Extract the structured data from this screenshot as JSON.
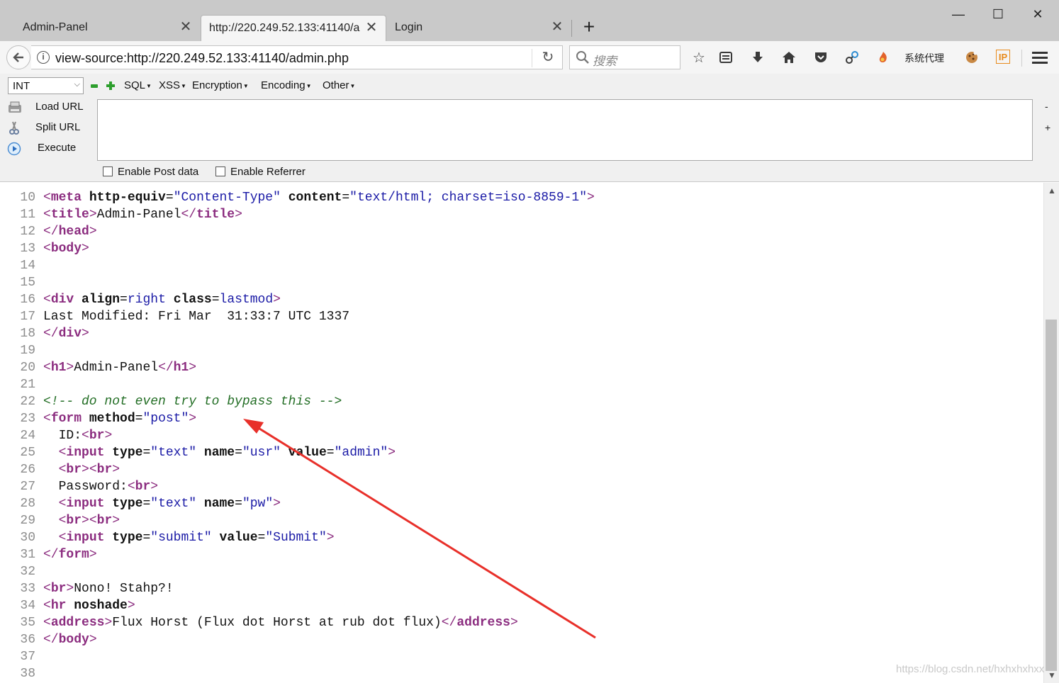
{
  "tabs": [
    {
      "label": "Admin-Panel"
    },
    {
      "label": "http://220.249.52.133:41140/a"
    },
    {
      "label": "Login"
    }
  ],
  "window_controls": {
    "minimize": "—",
    "maximize": "☐",
    "close": "✕"
  },
  "newtab_label": "+",
  "urlbar": {
    "url": "view-source:http://220.249.52.133:41140/admin.php"
  },
  "search": {
    "placeholder": "搜索"
  },
  "toolbar": {
    "proxy_label": "系统代理",
    "ip_label": "IP"
  },
  "hackbar": {
    "select_value": "INT",
    "menus": [
      "SQL",
      "XSS",
      "Encryption",
      "Encoding",
      "Other"
    ],
    "actions": [
      "Load URL",
      "Split URL",
      "Execute"
    ],
    "textarea_value": "",
    "side_buttons": [
      "-",
      "+"
    ],
    "checkboxes": [
      "Enable Post data",
      "Enable Referrer"
    ]
  },
  "source_lines": [
    {
      "n": "10",
      "segs": [
        [
          "br",
          "<"
        ],
        [
          "tag",
          "meta"
        ],
        [
          "txt",
          " "
        ],
        [
          "attr",
          "http-equiv"
        ],
        [
          "txt",
          "="
        ],
        [
          "val",
          "\"Content-Type\""
        ],
        [
          "txt",
          " "
        ],
        [
          "attr",
          "content"
        ],
        [
          "txt",
          "="
        ],
        [
          "val",
          "\"text/html; charset=iso-8859-1\""
        ],
        [
          "br",
          ">"
        ]
      ]
    },
    {
      "n": "11",
      "segs": [
        [
          "br",
          "<"
        ],
        [
          "tag",
          "title"
        ],
        [
          "br",
          ">"
        ],
        [
          "txt",
          "Admin-Panel"
        ],
        [
          "br",
          "</"
        ],
        [
          "tag",
          "title"
        ],
        [
          "br",
          ">"
        ]
      ]
    },
    {
      "n": "12",
      "segs": [
        [
          "br",
          "</"
        ],
        [
          "tag",
          "head"
        ],
        [
          "br",
          ">"
        ]
      ]
    },
    {
      "n": "13",
      "segs": [
        [
          "br",
          "<"
        ],
        [
          "tag",
          "body"
        ],
        [
          "br",
          ">"
        ]
      ]
    },
    {
      "n": "14",
      "segs": []
    },
    {
      "n": "15",
      "segs": []
    },
    {
      "n": "16",
      "segs": [
        [
          "br",
          "<"
        ],
        [
          "tag",
          "div"
        ],
        [
          "txt",
          " "
        ],
        [
          "attr",
          "align"
        ],
        [
          "txt",
          "="
        ],
        [
          "val",
          "right"
        ],
        [
          "txt",
          " "
        ],
        [
          "attr",
          "class"
        ],
        [
          "txt",
          "="
        ],
        [
          "val",
          "lastmod"
        ],
        [
          "br",
          ">"
        ]
      ]
    },
    {
      "n": "17",
      "segs": [
        [
          "txt",
          "Last Modified: Fri Mar  31:33:7 UTC 1337"
        ]
      ]
    },
    {
      "n": "18",
      "segs": [
        [
          "br",
          "</"
        ],
        [
          "tag",
          "div"
        ],
        [
          "br",
          ">"
        ]
      ]
    },
    {
      "n": "19",
      "segs": []
    },
    {
      "n": "20",
      "segs": [
        [
          "br",
          "<"
        ],
        [
          "tag",
          "h1"
        ],
        [
          "br",
          ">"
        ],
        [
          "txt",
          "Admin-Panel"
        ],
        [
          "br",
          "</"
        ],
        [
          "tag",
          "h1"
        ],
        [
          "br",
          ">"
        ]
      ]
    },
    {
      "n": "21",
      "segs": []
    },
    {
      "n": "22",
      "segs": [
        [
          "cmt",
          "<!-- do not even try to bypass this -->"
        ]
      ]
    },
    {
      "n": "23",
      "segs": [
        [
          "br",
          "<"
        ],
        [
          "tag",
          "form"
        ],
        [
          "txt",
          " "
        ],
        [
          "attr",
          "method"
        ],
        [
          "txt",
          "="
        ],
        [
          "val",
          "\"post\""
        ],
        [
          "br",
          ">"
        ]
      ]
    },
    {
      "n": "24",
      "segs": [
        [
          "txt",
          "  ID:"
        ],
        [
          "br",
          "<"
        ],
        [
          "tag",
          "br"
        ],
        [
          "br",
          ">"
        ]
      ]
    },
    {
      "n": "25",
      "segs": [
        [
          "txt",
          "  "
        ],
        [
          "br",
          "<"
        ],
        [
          "tag",
          "input"
        ],
        [
          "txt",
          " "
        ],
        [
          "attr",
          "type"
        ],
        [
          "txt",
          "="
        ],
        [
          "val",
          "\"text\""
        ],
        [
          "txt",
          " "
        ],
        [
          "attr",
          "name"
        ],
        [
          "txt",
          "="
        ],
        [
          "val",
          "\"usr\""
        ],
        [
          "txt",
          " "
        ],
        [
          "attr",
          "value"
        ],
        [
          "txt",
          "="
        ],
        [
          "val",
          "\"admin\""
        ],
        [
          "br",
          ">"
        ]
      ]
    },
    {
      "n": "26",
      "segs": [
        [
          "txt",
          "  "
        ],
        [
          "br",
          "<"
        ],
        [
          "tag",
          "br"
        ],
        [
          "br",
          "><"
        ],
        [
          "tag",
          "br"
        ],
        [
          "br",
          ">"
        ]
      ]
    },
    {
      "n": "27",
      "segs": [
        [
          "txt",
          "  Password:"
        ],
        [
          "br",
          "<"
        ],
        [
          "tag",
          "br"
        ],
        [
          "br",
          ">"
        ]
      ]
    },
    {
      "n": "28",
      "segs": [
        [
          "txt",
          "  "
        ],
        [
          "br",
          "<"
        ],
        [
          "tag",
          "input"
        ],
        [
          "txt",
          " "
        ],
        [
          "attr",
          "type"
        ],
        [
          "txt",
          "="
        ],
        [
          "val",
          "\"text\""
        ],
        [
          "txt",
          " "
        ],
        [
          "attr",
          "name"
        ],
        [
          "txt",
          "="
        ],
        [
          "val",
          "\"pw\""
        ],
        [
          "br",
          ">"
        ]
      ]
    },
    {
      "n": "29",
      "segs": [
        [
          "txt",
          "  "
        ],
        [
          "br",
          "<"
        ],
        [
          "tag",
          "br"
        ],
        [
          "br",
          "><"
        ],
        [
          "tag",
          "br"
        ],
        [
          "br",
          ">"
        ]
      ]
    },
    {
      "n": "30",
      "segs": [
        [
          "txt",
          "  "
        ],
        [
          "br",
          "<"
        ],
        [
          "tag",
          "input"
        ],
        [
          "txt",
          " "
        ],
        [
          "attr",
          "type"
        ],
        [
          "txt",
          "="
        ],
        [
          "val",
          "\"submit\""
        ],
        [
          "txt",
          " "
        ],
        [
          "attr",
          "value"
        ],
        [
          "txt",
          "="
        ],
        [
          "val",
          "\"Submit\""
        ],
        [
          "br",
          ">"
        ]
      ]
    },
    {
      "n": "31",
      "segs": [
        [
          "br",
          "</"
        ],
        [
          "tag",
          "form"
        ],
        [
          "br",
          ">"
        ]
      ]
    },
    {
      "n": "32",
      "segs": []
    },
    {
      "n": "33",
      "segs": [
        [
          "br",
          "<"
        ],
        [
          "tag",
          "br"
        ],
        [
          "br",
          ">"
        ],
        [
          "txt",
          "Nono! Stahp?!"
        ]
      ]
    },
    {
      "n": "34",
      "segs": [
        [
          "br",
          "<"
        ],
        [
          "tag",
          "hr"
        ],
        [
          "txt",
          " "
        ],
        [
          "attr",
          "noshade"
        ],
        [
          "br",
          ">"
        ]
      ]
    },
    {
      "n": "35",
      "segs": [
        [
          "br",
          "<"
        ],
        [
          "tag",
          "address"
        ],
        [
          "br",
          ">"
        ],
        [
          "txt",
          "Flux Horst (Flux dot Horst at rub dot flux)"
        ],
        [
          "br",
          "</"
        ],
        [
          "tag",
          "address"
        ],
        [
          "br",
          ">"
        ]
      ]
    },
    {
      "n": "36",
      "segs": [
        [
          "br",
          "</"
        ],
        [
          "tag",
          "body"
        ],
        [
          "br",
          ">"
        ]
      ]
    },
    {
      "n": "37",
      "segs": []
    },
    {
      "n": "38",
      "segs": []
    }
  ],
  "annotation_arrow_color": "#e8302a",
  "watermark": "https://blog.csdn.net/hxhxhxhxx"
}
